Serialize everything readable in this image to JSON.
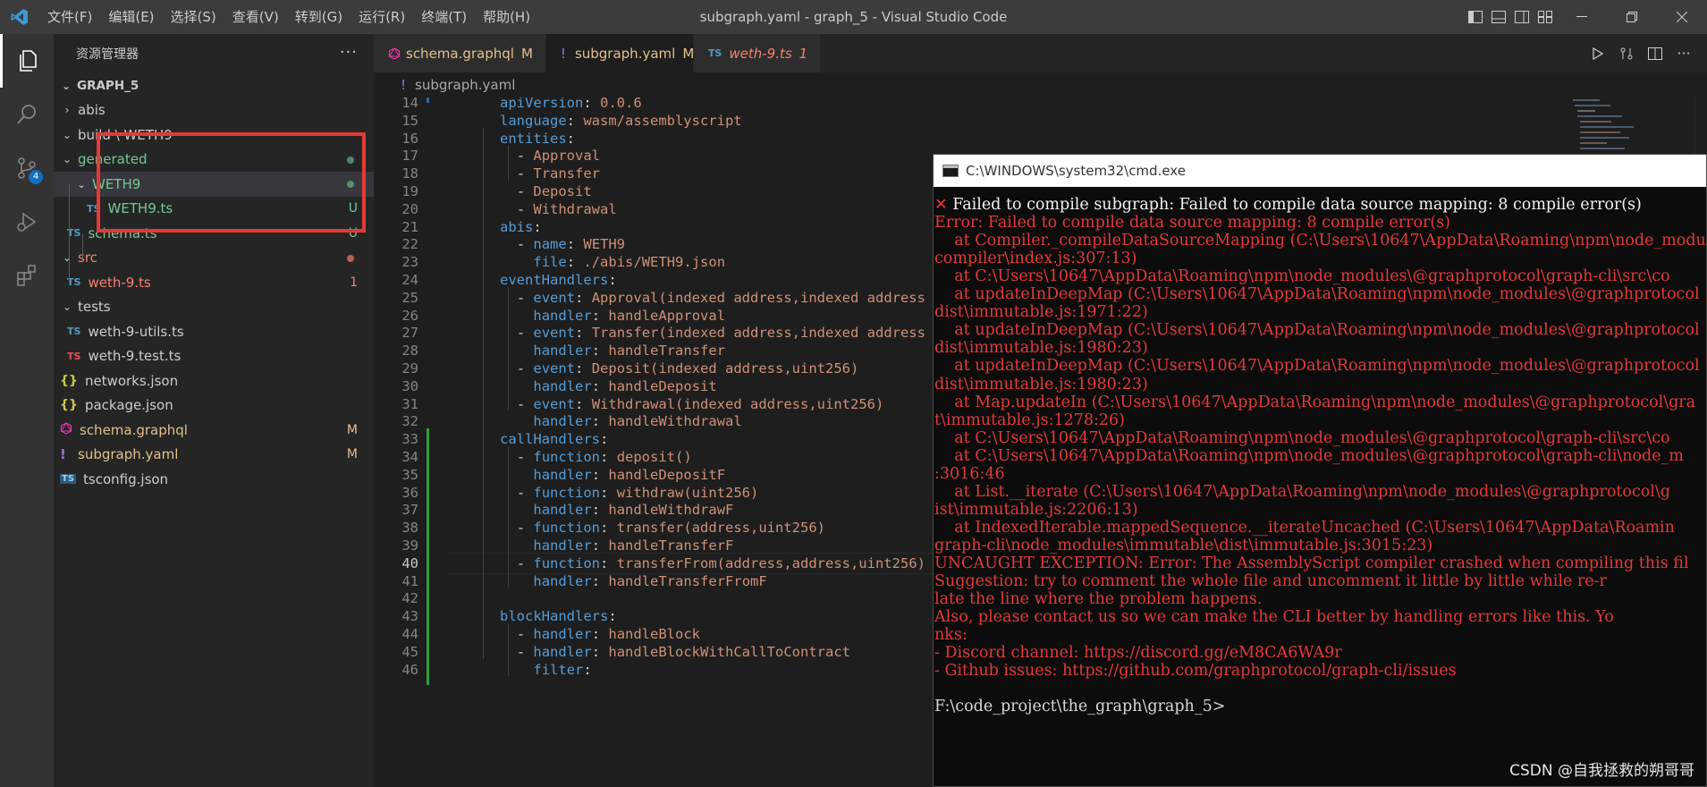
{
  "window": {
    "title": "subgraph.yaml - graph_5 - Visual Studio Code",
    "menu": [
      "文件(F)",
      "编辑(E)",
      "选择(S)",
      "查看(V)",
      "转到(G)",
      "运行(R)",
      "终端(T)",
      "帮助(H)"
    ]
  },
  "activity": {
    "source_control_badge": "4"
  },
  "sidebar": {
    "title": "资源管理器",
    "more": "···",
    "root": "GRAPH_5",
    "items": [
      {
        "label": "abis",
        "status": ""
      },
      {
        "label": "build \\ WETH9",
        "status": ""
      },
      {
        "label": "generated",
        "status": ""
      },
      {
        "label": "WETH9",
        "status": ""
      },
      {
        "label": "WETH9.ts",
        "icon": "TS",
        "status": "U"
      },
      {
        "label": "schema.ts",
        "icon": "TS",
        "status": "U"
      },
      {
        "label": "src",
        "status": ""
      },
      {
        "label": "weth-9.ts",
        "icon": "TS",
        "status": "1"
      },
      {
        "label": "tests",
        "status": ""
      },
      {
        "label": "weth-9-utils.ts",
        "icon": "TS",
        "status": ""
      },
      {
        "label": "weth-9.test.ts",
        "icon": "TS",
        "status": ""
      },
      {
        "label": "networks.json",
        "icon": "{}",
        "status": ""
      },
      {
        "label": "package.json",
        "icon": "{}",
        "status": ""
      },
      {
        "label": "schema.graphql",
        "status": "M"
      },
      {
        "label": "subgraph.yaml",
        "icon": "!",
        "status": "M"
      },
      {
        "label": "tsconfig.json",
        "icon": "TS",
        "status": ""
      }
    ]
  },
  "tabs": [
    {
      "label": "schema.graphql",
      "badge": "M"
    },
    {
      "label": "subgraph.yaml",
      "icon": "!",
      "badge": "M",
      "close": "×"
    },
    {
      "label": "weth-9.ts",
      "icon": "TS",
      "badge": "1"
    }
  ],
  "breadcrumb": {
    "icon": "!",
    "label": "subgraph.yaml"
  },
  "editor": {
    "current_line": "40",
    "lines": [
      {
        "n": "14",
        "key": "apiVersion",
        "val": "0.0.6"
      },
      {
        "n": "15",
        "key": "language",
        "val": "wasm/assemblyscript"
      },
      {
        "n": "16",
        "key": "entities",
        "val": ""
      },
      {
        "n": "17",
        "dash": "- ",
        "val": "Approval"
      },
      {
        "n": "18",
        "dash": "- ",
        "val": "Transfer"
      },
      {
        "n": "19",
        "dash": "- ",
        "val": "Deposit"
      },
      {
        "n": "20",
        "dash": "- ",
        "val": "Withdrawal"
      },
      {
        "n": "21",
        "key": "abis",
        "val": ""
      },
      {
        "n": "22",
        "dash": "- ",
        "key": "name",
        "val": "WETH9"
      },
      {
        "n": "23",
        "key": "file",
        "val": "./abis/WETH9.json"
      },
      {
        "n": "24",
        "key": "eventHandlers",
        "val": ""
      },
      {
        "n": "25",
        "dash": "- ",
        "key": "event",
        "val": "Approval(indexed address,indexed address"
      },
      {
        "n": "26",
        "key": "handler",
        "val": "handleApproval"
      },
      {
        "n": "27",
        "dash": "- ",
        "key": "event",
        "val": "Transfer(indexed address,indexed address"
      },
      {
        "n": "28",
        "key": "handler",
        "val": "handleTransfer"
      },
      {
        "n": "29",
        "dash": "- ",
        "key": "event",
        "val": "Deposit(indexed address,uint256)"
      },
      {
        "n": "30",
        "key": "handler",
        "val": "handleDeposit"
      },
      {
        "n": "31",
        "dash": "- ",
        "key": "event",
        "val": "Withdrawal(indexed address,uint256)"
      },
      {
        "n": "32",
        "key": "handler",
        "val": "handleWithdrawal"
      },
      {
        "n": "33",
        "key": "callHandlers",
        "val": ""
      },
      {
        "n": "34",
        "dash": "- ",
        "key": "function",
        "val": "deposit()"
      },
      {
        "n": "35",
        "key": "handler",
        "val": "handleDepositF"
      },
      {
        "n": "36",
        "dash": "- ",
        "key": "function",
        "val": "withdraw(uint256)"
      },
      {
        "n": "37",
        "key": "handler",
        "val": "handleWithdrawF"
      },
      {
        "n": "38",
        "dash": "- ",
        "key": "function",
        "val": "transfer(address,uint256)"
      },
      {
        "n": "39",
        "key": "handler",
        "val": "handleTransferF"
      },
      {
        "n": "40",
        "dash": "- ",
        "key": "function",
        "val": "transferFrom(address,address,uint256)"
      },
      {
        "n": "41",
        "key": "handler",
        "val": "handleTransferFromF"
      },
      {
        "n": "42",
        "val": ""
      },
      {
        "n": "43",
        "key": "blockHandlers",
        "val": ""
      },
      {
        "n": "44",
        "dash": "- ",
        "key": "handler",
        "val": "handleBlock"
      },
      {
        "n": "45",
        "dash": "- ",
        "key": "handler",
        "val": "handleBlockWithCallToContract"
      },
      {
        "n": "46",
        "key": "filter",
        "val": ""
      }
    ]
  },
  "cmd": {
    "title": "C:\\WINDOWS\\system32\\cmd.exe",
    "error_mark": "✕",
    "lines": [
      " Failed to compile subgraph: Failed to compile data source mapping: 8 compile error(s)",
      "Error: Failed to compile data source mapping: 8 compile error(s)",
      "    at Compiler._compileDataSourceMapping (C:\\Users\\10647\\AppData\\Roaming\\npm\\node_modu",
      "compiler\\index.js:307:13)",
      "    at C:\\Users\\10647\\AppData\\Roaming\\npm\\node_modules\\@graphprotocol\\graph-cli\\src\\co",
      "    at updateInDeepMap (C:\\Users\\10647\\AppData\\Roaming\\npm\\node_modules\\@graphprotocol",
      "dist\\immutable.js:1971:22)",
      "    at updateInDeepMap (C:\\Users\\10647\\AppData\\Roaming\\npm\\node_modules\\@graphprotocol",
      "dist\\immutable.js:1980:23)",
      "    at updateInDeepMap (C:\\Users\\10647\\AppData\\Roaming\\npm\\node_modules\\@graphprotocol",
      "dist\\immutable.js:1980:23)",
      "    at Map.updateIn (C:\\Users\\10647\\AppData\\Roaming\\npm\\node_modules\\@graphprotocol\\gra",
      "t\\immutable.js:1278:26)",
      "    at C:\\Users\\10647\\AppData\\Roaming\\npm\\node_modules\\@graphprotocol\\graph-cli\\src\\co",
      "    at C:\\Users\\10647\\AppData\\Roaming\\npm\\node_modules\\@graphprotocol\\graph-cli\\node_m",
      ":3016:46",
      "    at List.__iterate (C:\\Users\\10647\\AppData\\Roaming\\npm\\node_modules\\@graphprotocol\\g",
      "ist\\immutable.js:2206:13)",
      "    at IndexedIterable.mappedSequence.__iterateUncached (C:\\Users\\10647\\AppData\\Roamin",
      "graph-cli\\node_modules\\immutable\\dist\\immutable.js:3015:23)",
      "UNCAUGHT EXCEPTION: Error: The AssemblyScript compiler crashed when compiling this fil",
      "Suggestion: try to comment the whole file and uncomment it little by little while re-r",
      "late the line where the problem happens.",
      "Also, please contact us so we can make the CLI better by handling errors like this. Yo",
      "nks:",
      "- Discord channel: https://discord.gg/eM8CA6WA9r",
      "- Github issues: https://github.com/graphprotocol/graph-cli/issues",
      "",
      "F:\\code_project\\the_graph\\graph_5>"
    ]
  },
  "watermark": "CSDN @自我拯救的朔哥哥"
}
